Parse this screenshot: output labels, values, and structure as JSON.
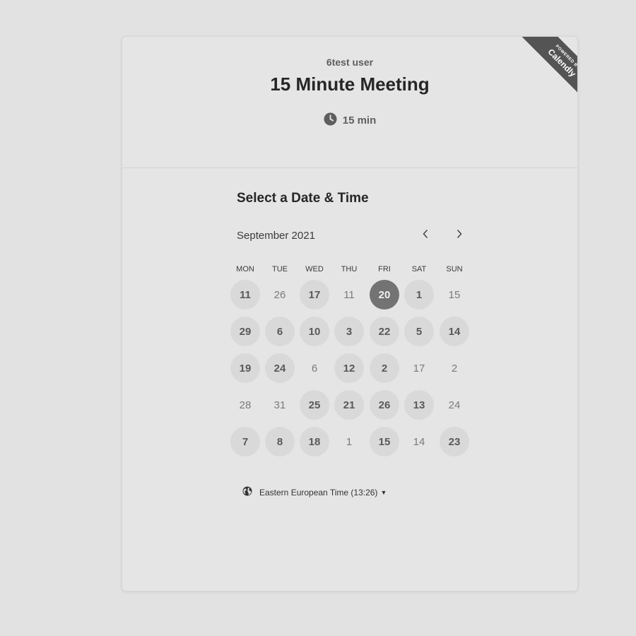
{
  "event": {
    "owner": "6test user",
    "title": "15 Minute Meeting",
    "duration": "15 min",
    "icon": "clock-icon"
  },
  "badge": {
    "line1": "POWERED BY",
    "line2": "Calendly"
  },
  "calendar": {
    "heading": "Select a Date & Time",
    "month": "September 2021",
    "weekdays": [
      "MON",
      "TUE",
      "WED",
      "THU",
      "FRI",
      "SAT",
      "SUN"
    ],
    "weeks": [
      [
        {
          "n": "11",
          "s": "available"
        },
        {
          "n": "26",
          "s": "unavailable"
        },
        {
          "n": "17",
          "s": "available"
        },
        {
          "n": "11",
          "s": "unavailable"
        },
        {
          "n": "20",
          "s": "selected"
        },
        {
          "n": "1",
          "s": "available"
        },
        {
          "n": "15",
          "s": "unavailable"
        }
      ],
      [
        {
          "n": "29",
          "s": "available"
        },
        {
          "n": "6",
          "s": "available"
        },
        {
          "n": "10",
          "s": "available"
        },
        {
          "n": "3",
          "s": "available"
        },
        {
          "n": "22",
          "s": "available"
        },
        {
          "n": "5",
          "s": "available"
        },
        {
          "n": "14",
          "s": "available"
        }
      ],
      [
        {
          "n": "19",
          "s": "available"
        },
        {
          "n": "24",
          "s": "available"
        },
        {
          "n": "6",
          "s": "unavailable"
        },
        {
          "n": "12",
          "s": "available"
        },
        {
          "n": "2",
          "s": "available"
        },
        {
          "n": "17",
          "s": "unavailable"
        },
        {
          "n": "2",
          "s": "unavailable"
        }
      ],
      [
        {
          "n": "28",
          "s": "unavailable"
        },
        {
          "n": "31",
          "s": "unavailable"
        },
        {
          "n": "25",
          "s": "available"
        },
        {
          "n": "21",
          "s": "available"
        },
        {
          "n": "26",
          "s": "available"
        },
        {
          "n": "13",
          "s": "available"
        },
        {
          "n": "24",
          "s": "unavailable"
        }
      ],
      [
        {
          "n": "7",
          "s": "available"
        },
        {
          "n": "8",
          "s": "available"
        },
        {
          "n": "18",
          "s": "available"
        },
        {
          "n": "1",
          "s": "unavailable"
        },
        {
          "n": "15",
          "s": "available"
        },
        {
          "n": "14",
          "s": "unavailable"
        },
        {
          "n": "23",
          "s": "available"
        }
      ]
    ]
  },
  "timezone": {
    "label": "Eastern European Time (13:26)",
    "icon": "globe-icon"
  }
}
